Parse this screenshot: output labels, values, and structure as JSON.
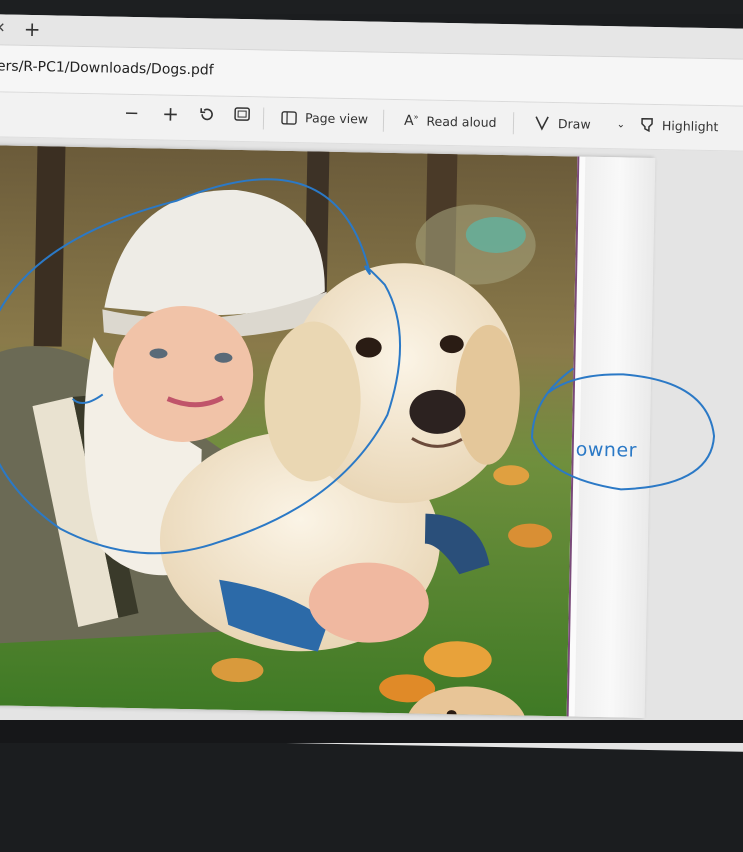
{
  "tabs": {
    "close_icon": "close-icon",
    "new_tab_icon": "plus-icon"
  },
  "address": {
    "url": "ers/R-PC1/Downloads/Dogs.pdf"
  },
  "toolbar": {
    "zoom_out": "−",
    "zoom_in": "+",
    "page_view_label": "Page view",
    "read_aloud_label": "Read aloud",
    "draw_label": "Draw",
    "highlight_label": "Highlight"
  },
  "document": {
    "image_subject": "child hugging golden retriever on autumn lawn",
    "annotation_text": "owner",
    "ink_color": "#2b79c6"
  }
}
